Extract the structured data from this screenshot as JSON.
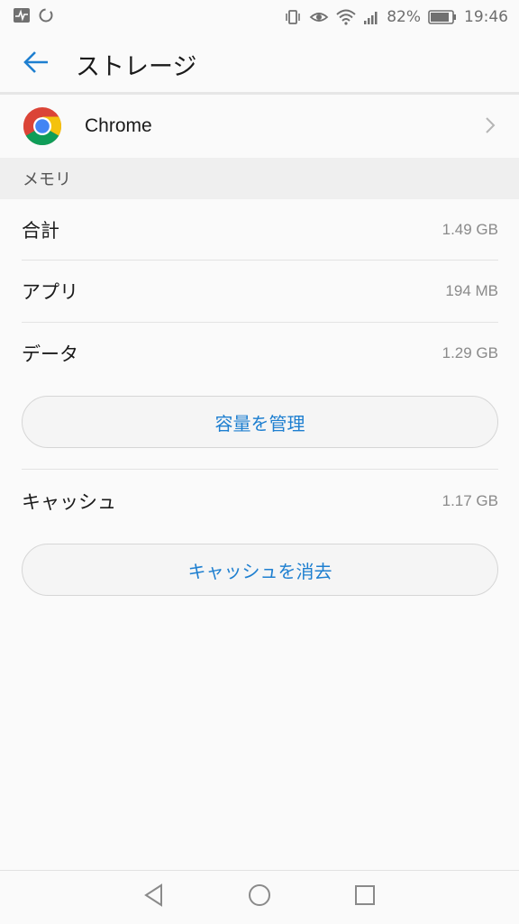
{
  "status_bar": {
    "battery_percent": "82%",
    "time": "19:46",
    "icons": [
      "activity-monitor-icon",
      "sync-icon",
      "vibrate-icon",
      "eye-comfort-icon",
      "wifi-icon",
      "signal-icon",
      "battery-icon"
    ]
  },
  "header": {
    "title": "ストレージ",
    "back_icon": "arrow-back-icon"
  },
  "app": {
    "name": "Chrome",
    "icon": "chrome-logo-icon"
  },
  "memory_section": {
    "header": "メモリ",
    "rows": [
      {
        "label": "合計",
        "value": "1.49 GB"
      },
      {
        "label": "アプリ",
        "value": "194 MB"
      },
      {
        "label": "データ",
        "value": "1.29 GB"
      }
    ],
    "manage_button": "容量を管理"
  },
  "cache_section": {
    "label": "キャッシュ",
    "value": "1.17 GB",
    "clear_button": "キャッシュを消去"
  },
  "colors": {
    "accent": "#1e7fd0",
    "background": "#fafafa",
    "section_bg": "#efefef"
  }
}
